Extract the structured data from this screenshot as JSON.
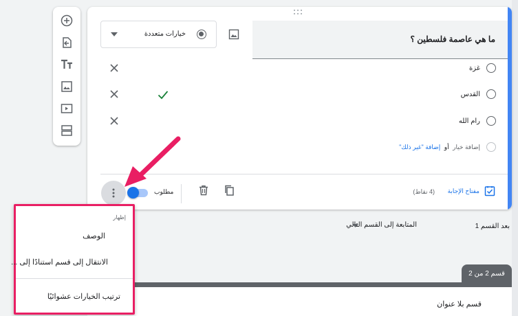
{
  "toolbar": {
    "items": [
      "add-question",
      "import-questions",
      "add-title",
      "add-image",
      "add-video",
      "add-section"
    ]
  },
  "question": {
    "title": "ما هي عاصمة فلسطين ؟",
    "type_label": "خيارات متعددة",
    "options": [
      {
        "label": "غزة",
        "correct": false
      },
      {
        "label": "القدس",
        "correct": true
      },
      {
        "label": "رام الله",
        "correct": false
      }
    ],
    "add_option_label": "إضافة خيار",
    "or_label": "أو",
    "add_other_label": "إضافة \"غير ذلك\""
  },
  "footer": {
    "answer_key_label": "مفتاح الإجابة",
    "points_label": "(4 نقاط)",
    "required_label": "مطلوب",
    "required_on": true
  },
  "section_nav": {
    "after_label": "بعد القسم 1",
    "continue_label": "المتابعة إلى القسم التالي"
  },
  "section": {
    "badge": "قسم 2 من 2",
    "title": "قسم بلا عنوان"
  },
  "menu": {
    "heading": "إظهار",
    "items": [
      "الوصف",
      "الانتقال إلى قسم استنادًا إلى ...",
      "ترتيب الخيارات عشوائيًا"
    ]
  },
  "colors": {
    "accent": "#4285f4",
    "highlight": "#e91e63",
    "correct": "#188038",
    "link": "#1a73e8"
  }
}
